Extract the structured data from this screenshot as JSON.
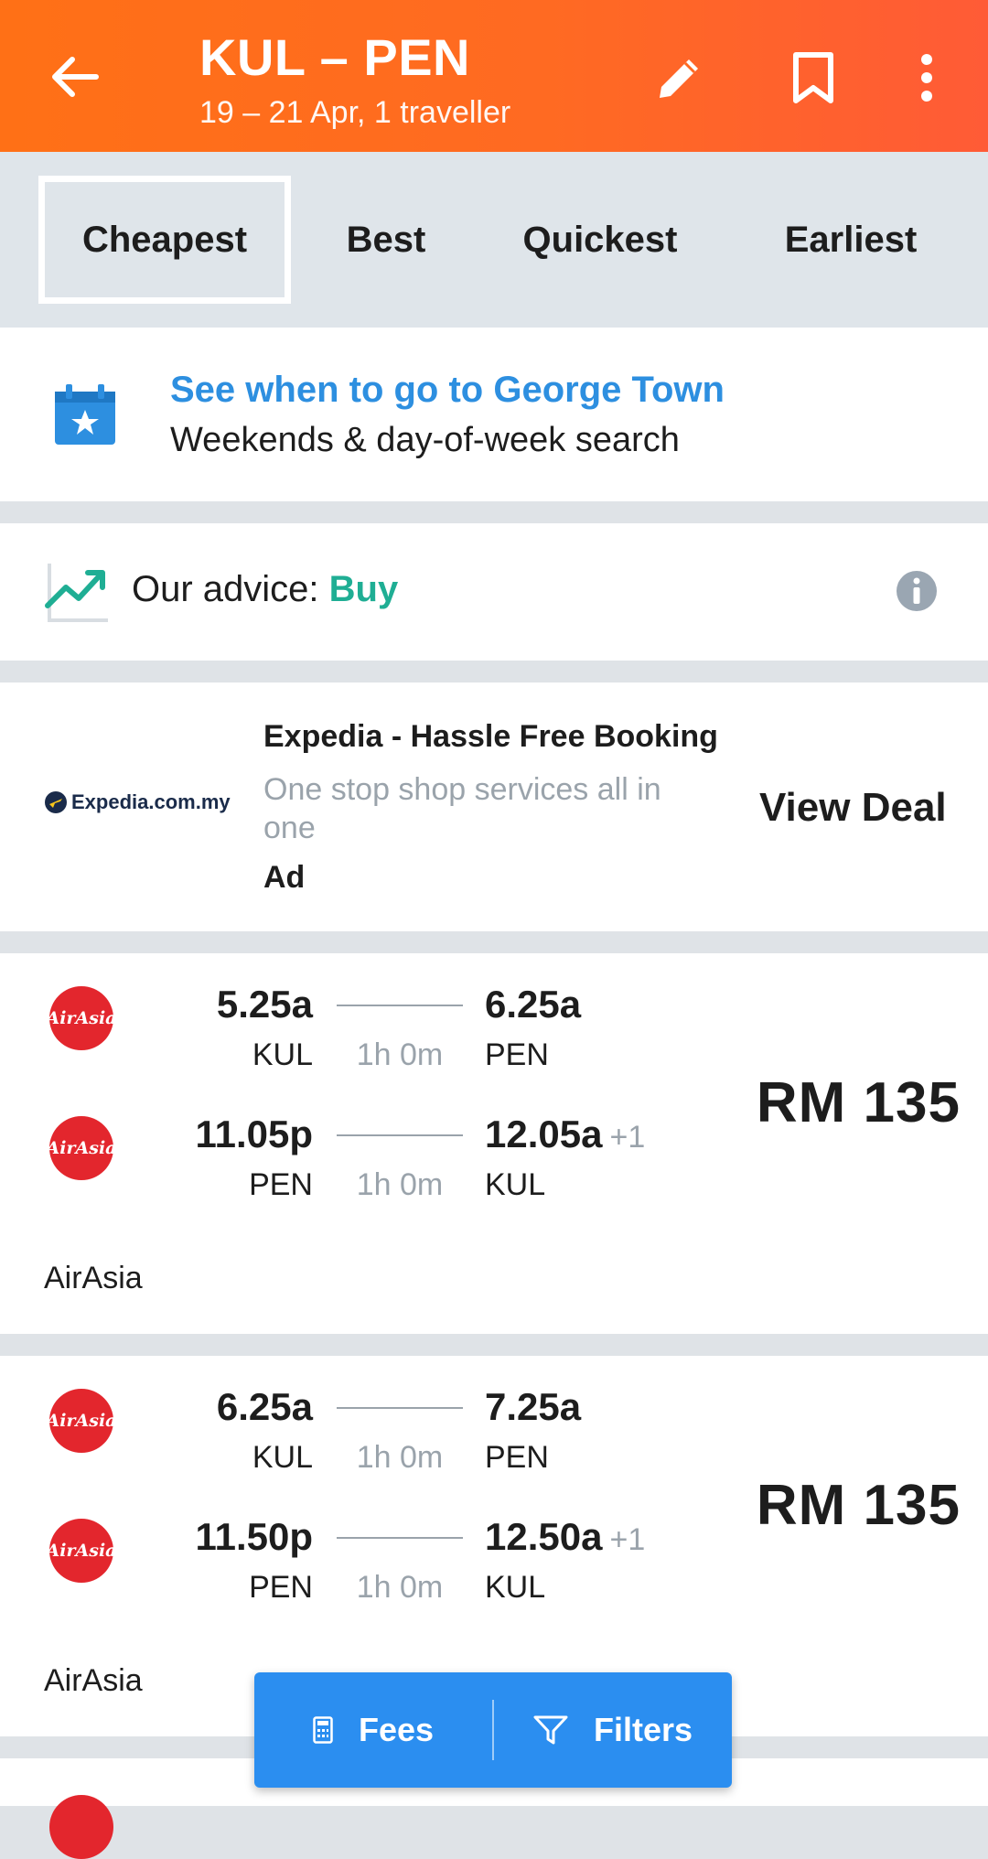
{
  "header": {
    "title": "KUL – PEN",
    "subtitle": "19 – 21 Apr, 1 traveller"
  },
  "sort_tabs": [
    {
      "label": "Cheapest",
      "active": true
    },
    {
      "label": "Best",
      "active": false
    },
    {
      "label": "Quickest",
      "active": false
    },
    {
      "label": "Earliest",
      "active": false
    }
  ],
  "calendar_promo": {
    "title": "See when to go to George Town",
    "subtitle": "Weekends & day-of-week search"
  },
  "advice": {
    "label": "Our advice: ",
    "value": "Buy"
  },
  "ad": {
    "logo_text": "Expedia.com.my",
    "title": "Expedia - Hassle Free Booking",
    "description": "One stop shop services all in one",
    "tag": "Ad",
    "cta": "View Deal"
  },
  "flights": [
    {
      "airline": "AirAsia",
      "logo_text": "AirAsia",
      "price": "RM 135",
      "legs": [
        {
          "dep_time": "5.25a",
          "dep_code": "KUL",
          "duration": "1h 0m",
          "arr_time": "6.25a",
          "arr_code": "PEN",
          "plus_day": ""
        },
        {
          "dep_time": "11.05p",
          "dep_code": "PEN",
          "duration": "1h 0m",
          "arr_time": "12.05a",
          "arr_code": "KUL",
          "plus_day": "+1"
        }
      ]
    },
    {
      "airline": "AirAsia",
      "logo_text": "AirAsia",
      "price": "RM 135",
      "legs": [
        {
          "dep_time": "6.25a",
          "dep_code": "KUL",
          "duration": "1h 0m",
          "arr_time": "7.25a",
          "arr_code": "PEN",
          "plus_day": ""
        },
        {
          "dep_time": "11.50p",
          "dep_code": "PEN",
          "duration": "1h 0m",
          "arr_time": "12.50a",
          "arr_code": "KUL",
          "plus_day": "+1"
        }
      ]
    }
  ],
  "float_bar": {
    "fees_label": "Fees",
    "filters_label": "Filters"
  },
  "colors": {
    "header_orange": "#ff6a22",
    "accent_blue": "#2b8ef0",
    "advice_green": "#1fae94",
    "airasia_red": "#e3262d"
  }
}
